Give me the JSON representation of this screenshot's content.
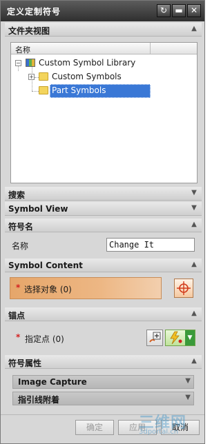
{
  "window": {
    "title": "定义定制符号",
    "reset_glyph": "↻",
    "minimize_glyph": "▬",
    "close_glyph": "✕"
  },
  "sections": {
    "folder_view": "文件夹视图",
    "search": "搜索",
    "symbol_view": "Symbol View",
    "symbol_name": "符号名",
    "symbol_content": "Symbol Content",
    "anchor": "锚点",
    "symbol_props": "符号属性"
  },
  "tree": {
    "column_header": "名称",
    "nodes": [
      {
        "label": "Custom Symbol Library",
        "expander": "−"
      },
      {
        "label": "Custom Symbols",
        "expander": "+"
      },
      {
        "label": "Part Symbols",
        "expander": ""
      }
    ]
  },
  "name_row": {
    "label": "名称",
    "value": "Change It"
  },
  "symbol_content": {
    "required_mark": "*",
    "select_label": "选择对象 (0)"
  },
  "anchor": {
    "required_mark": "*",
    "point_label": "指定点 (0)"
  },
  "subsections": {
    "image_capture": "Image Capture",
    "leader_attach": "指引线附着"
  },
  "buttons": {
    "ok": "确定",
    "apply": "应用",
    "cancel": "取消"
  },
  "watermark": {
    "text_big": "三维网",
    "text_small": "3dportal.cn"
  },
  "colors": {
    "selection": "#3a78d6",
    "accent_orange": "#e6a66a",
    "required_star": "#d42020"
  }
}
